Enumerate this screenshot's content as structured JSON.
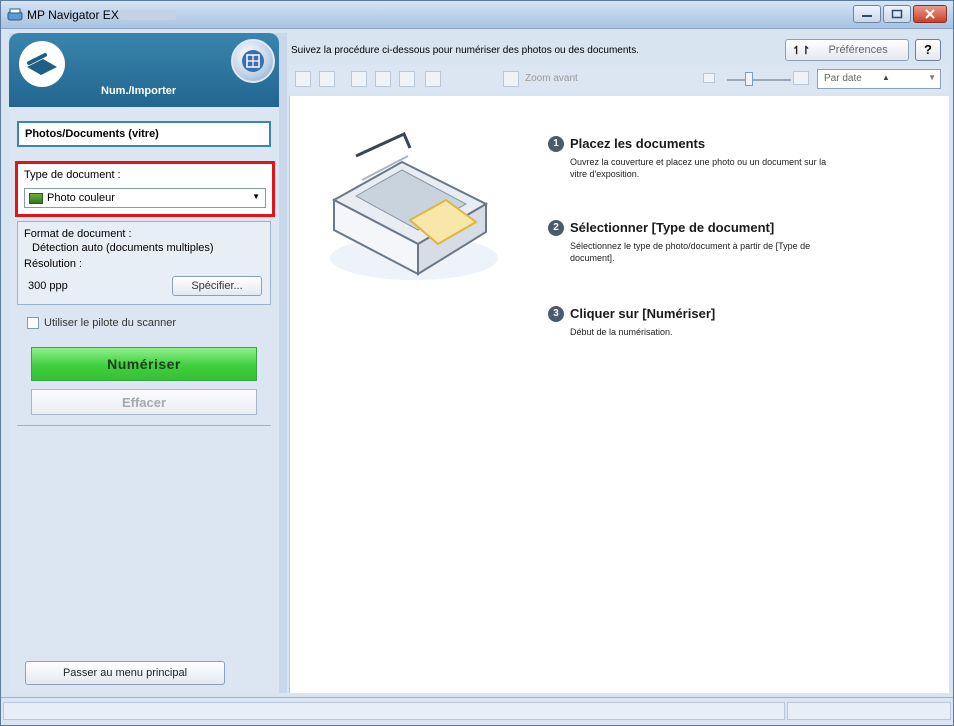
{
  "window": {
    "title": "MP Navigator EX"
  },
  "left_panel": {
    "header_label": "Num./Importer",
    "mode_button": "Photos/Documents (vitre)",
    "doctype_label": "Type de document :",
    "doctype_value": "Photo couleur",
    "format_label": "Format de document :",
    "format_value": "Détection auto (documents multiples)",
    "resolution_label": "Résolution :",
    "resolution_value": "300 ppp",
    "specify_button": "Spécifier...",
    "scanner_driver_label": "Utiliser le pilote du scanner",
    "scan_button": "Numériser",
    "clear_button": "Effacer",
    "back_button": "Passer au menu principal"
  },
  "right_panel": {
    "instruction": "Suivez la procédure ci-dessous pour numériser des photos ou des documents.",
    "preferences_button": "Préférences",
    "help_button": "?",
    "zoom_label": "Zoom avant",
    "sort_value": "Par date",
    "steps": [
      {
        "num": "1",
        "title": "Placez les documents",
        "desc": "Ouvrez la couverture et placez une photo ou un document sur la vitre d'exposition."
      },
      {
        "num": "2",
        "title": "Sélectionner [Type de document]",
        "desc": "Sélectionnez le type de photo/document à partir de [Type de document]."
      },
      {
        "num": "3",
        "title": "Cliquer sur [Numériser]",
        "desc": "Début de la numérisation."
      }
    ]
  },
  "colors": {
    "accent": "#216690",
    "highlight": "#e0141b",
    "scan_button": "#3fcf3e"
  }
}
